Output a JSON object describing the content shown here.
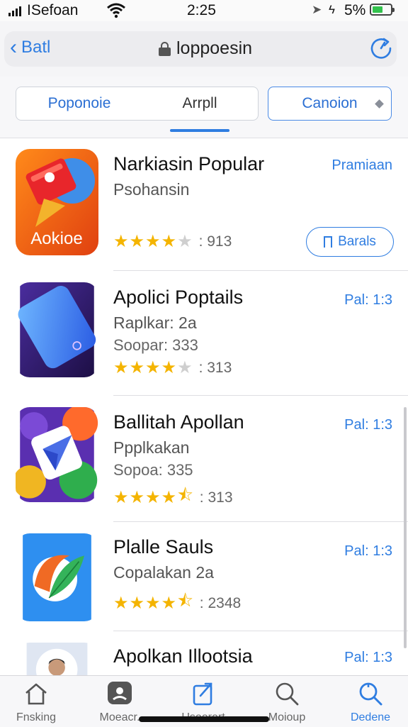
{
  "status_bar": {
    "carrier": "ISefoan",
    "time": "2:25",
    "battery_percent": "5%",
    "battery_level": 0.6,
    "battery_color": "#33c24d"
  },
  "navbar": {
    "back_label": "Batl",
    "url": "loppoesin",
    "accent": "#2f7de1"
  },
  "segments": [
    {
      "label": "Poponoie"
    },
    {
      "label": "Arrpll"
    },
    {
      "label": "Canoion"
    }
  ],
  "apps": [
    {
      "title": "Narkiasin Popular",
      "subtitle": "Psohansin",
      "meta": "",
      "right": "Pramiaan",
      "stars": 4,
      "count": ": 913",
      "button": "Barals",
      "icon": "red-book-icon"
    },
    {
      "title": "Apolici Poptails",
      "subtitle": "Raplkar: 2a",
      "meta": "Soopar: 333",
      "right": "Pal: 1:3",
      "stars": 4,
      "count": ": 313",
      "button": "",
      "icon": "blue-phone-icon"
    },
    {
      "title": "Ballitah Apollan",
      "subtitle": "Ppplkakan",
      "meta": "Sopoa: 335",
      "right": "Pal: 1:3",
      "stars": 4.5,
      "count": ": 313",
      "button": "",
      "icon": "paper-plane-icon"
    },
    {
      "title": "Plalle Sauls",
      "subtitle": "Copalakan 2a",
      "meta": "",
      "right": "Pal: 1:3",
      "stars": 4.5,
      "count": ": 2348",
      "button": "",
      "icon": "leaf-swoosh-icon"
    },
    {
      "title": "Apolkan Illootsia",
      "subtitle": "",
      "meta": "",
      "right": "Pal: 1:3",
      "stars": 0,
      "count": "",
      "button": "",
      "icon": "person-avatar-icon"
    }
  ],
  "tabs": [
    {
      "label": "Fnsking",
      "icon": "home-icon",
      "active": false
    },
    {
      "label": "Moeacr.",
      "icon": "chat-icon",
      "active": false
    },
    {
      "label": "Usoorort",
      "icon": "share-icon",
      "active": false
    },
    {
      "label": "Moioup",
      "icon": "search-icon",
      "active": false
    },
    {
      "label": "Dedene",
      "icon": "search-icon",
      "active": true
    }
  ]
}
